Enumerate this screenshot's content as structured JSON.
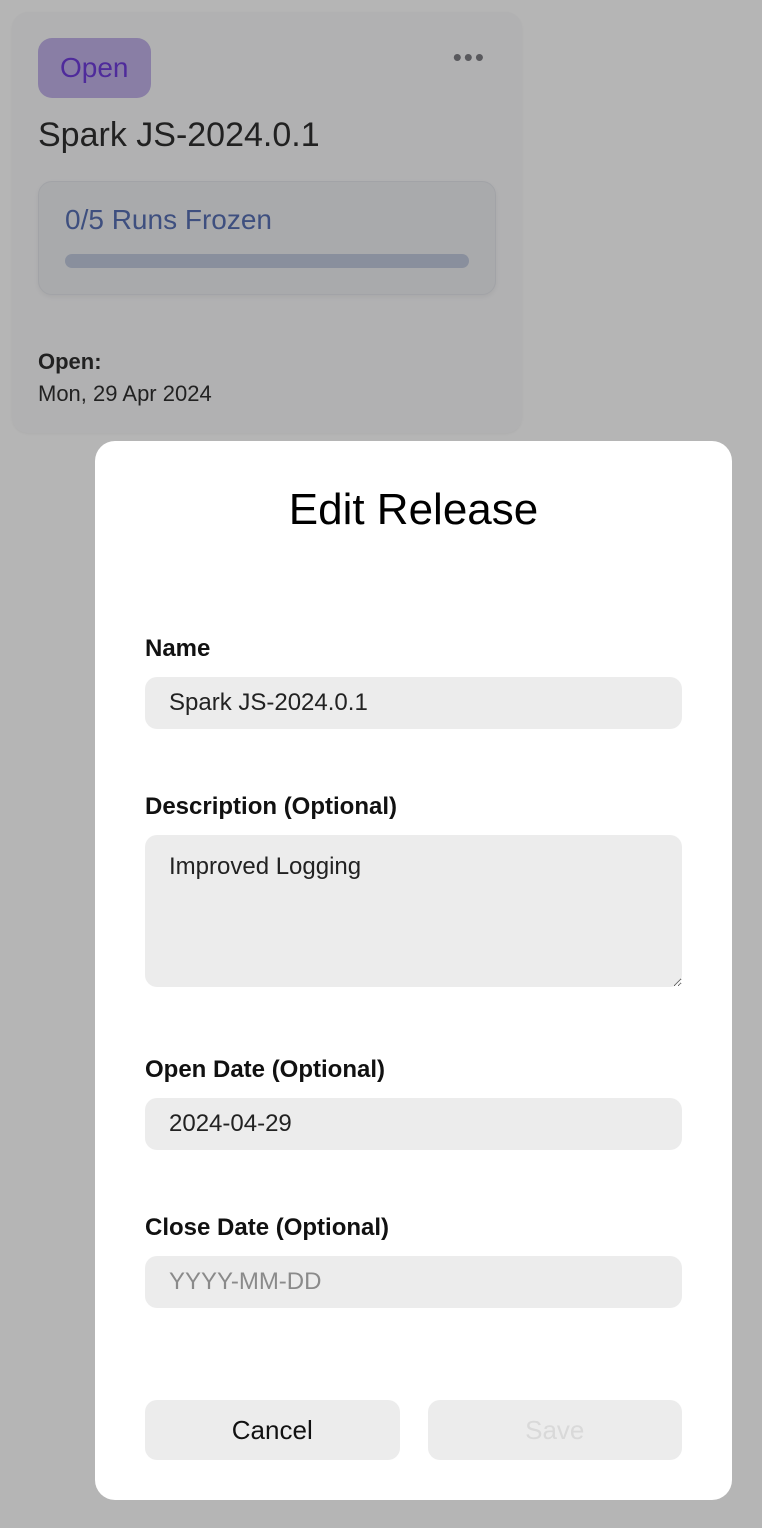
{
  "card": {
    "status_badge": "Open",
    "title": "Spark JS-2024.0.1",
    "runs_text": "0/5 Runs Frozen",
    "open_label": "Open:",
    "open_date": "Mon, 29 Apr 2024"
  },
  "modal": {
    "title": "Edit Release",
    "fields": {
      "name": {
        "label": "Name",
        "value": "Spark JS-2024.0.1"
      },
      "description": {
        "label": "Description (Optional)",
        "value": "Improved Logging"
      },
      "open_date": {
        "label": "Open Date (Optional)",
        "value": "2024-04-29"
      },
      "close_date": {
        "label": "Close Date (Optional)",
        "value": "",
        "placeholder": "YYYY-MM-DD"
      }
    },
    "buttons": {
      "cancel": "Cancel",
      "save": "Save"
    }
  }
}
